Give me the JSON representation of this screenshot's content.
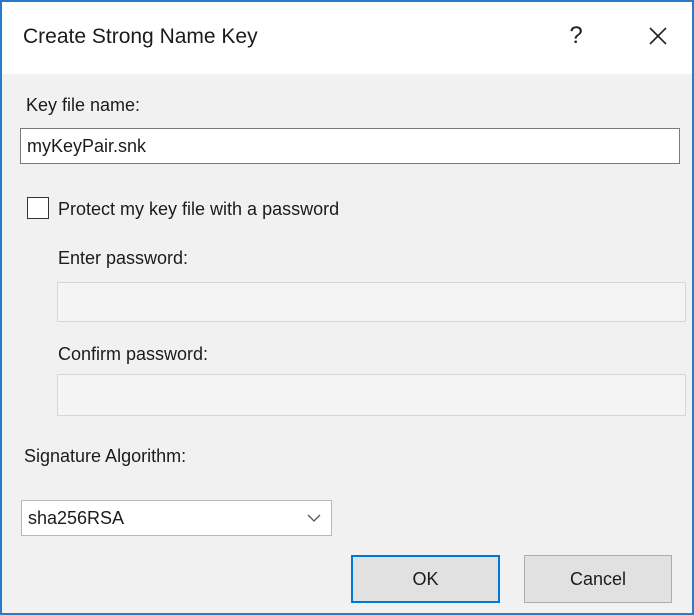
{
  "window": {
    "title": "Create Strong Name Key",
    "help_glyph": "?",
    "close_icon": "close-icon"
  },
  "key_file": {
    "label": "Key file name:",
    "value": "myKeyPair.snk"
  },
  "protect": {
    "label": "Protect my key file with a password",
    "checked": false
  },
  "password": {
    "enter_label": "Enter password:",
    "confirm_label": "Confirm password:",
    "enter_value": "",
    "confirm_value": ""
  },
  "signature": {
    "label": "Signature Algorithm:",
    "selected": "sha256RSA",
    "arrow_icon": "chevron-down-icon"
  },
  "buttons": {
    "ok": "OK",
    "cancel": "Cancel"
  },
  "colors": {
    "window_border": "#2b79c9",
    "dialog_background": "#f1f1f1",
    "default_button_border": "#0078d7"
  }
}
